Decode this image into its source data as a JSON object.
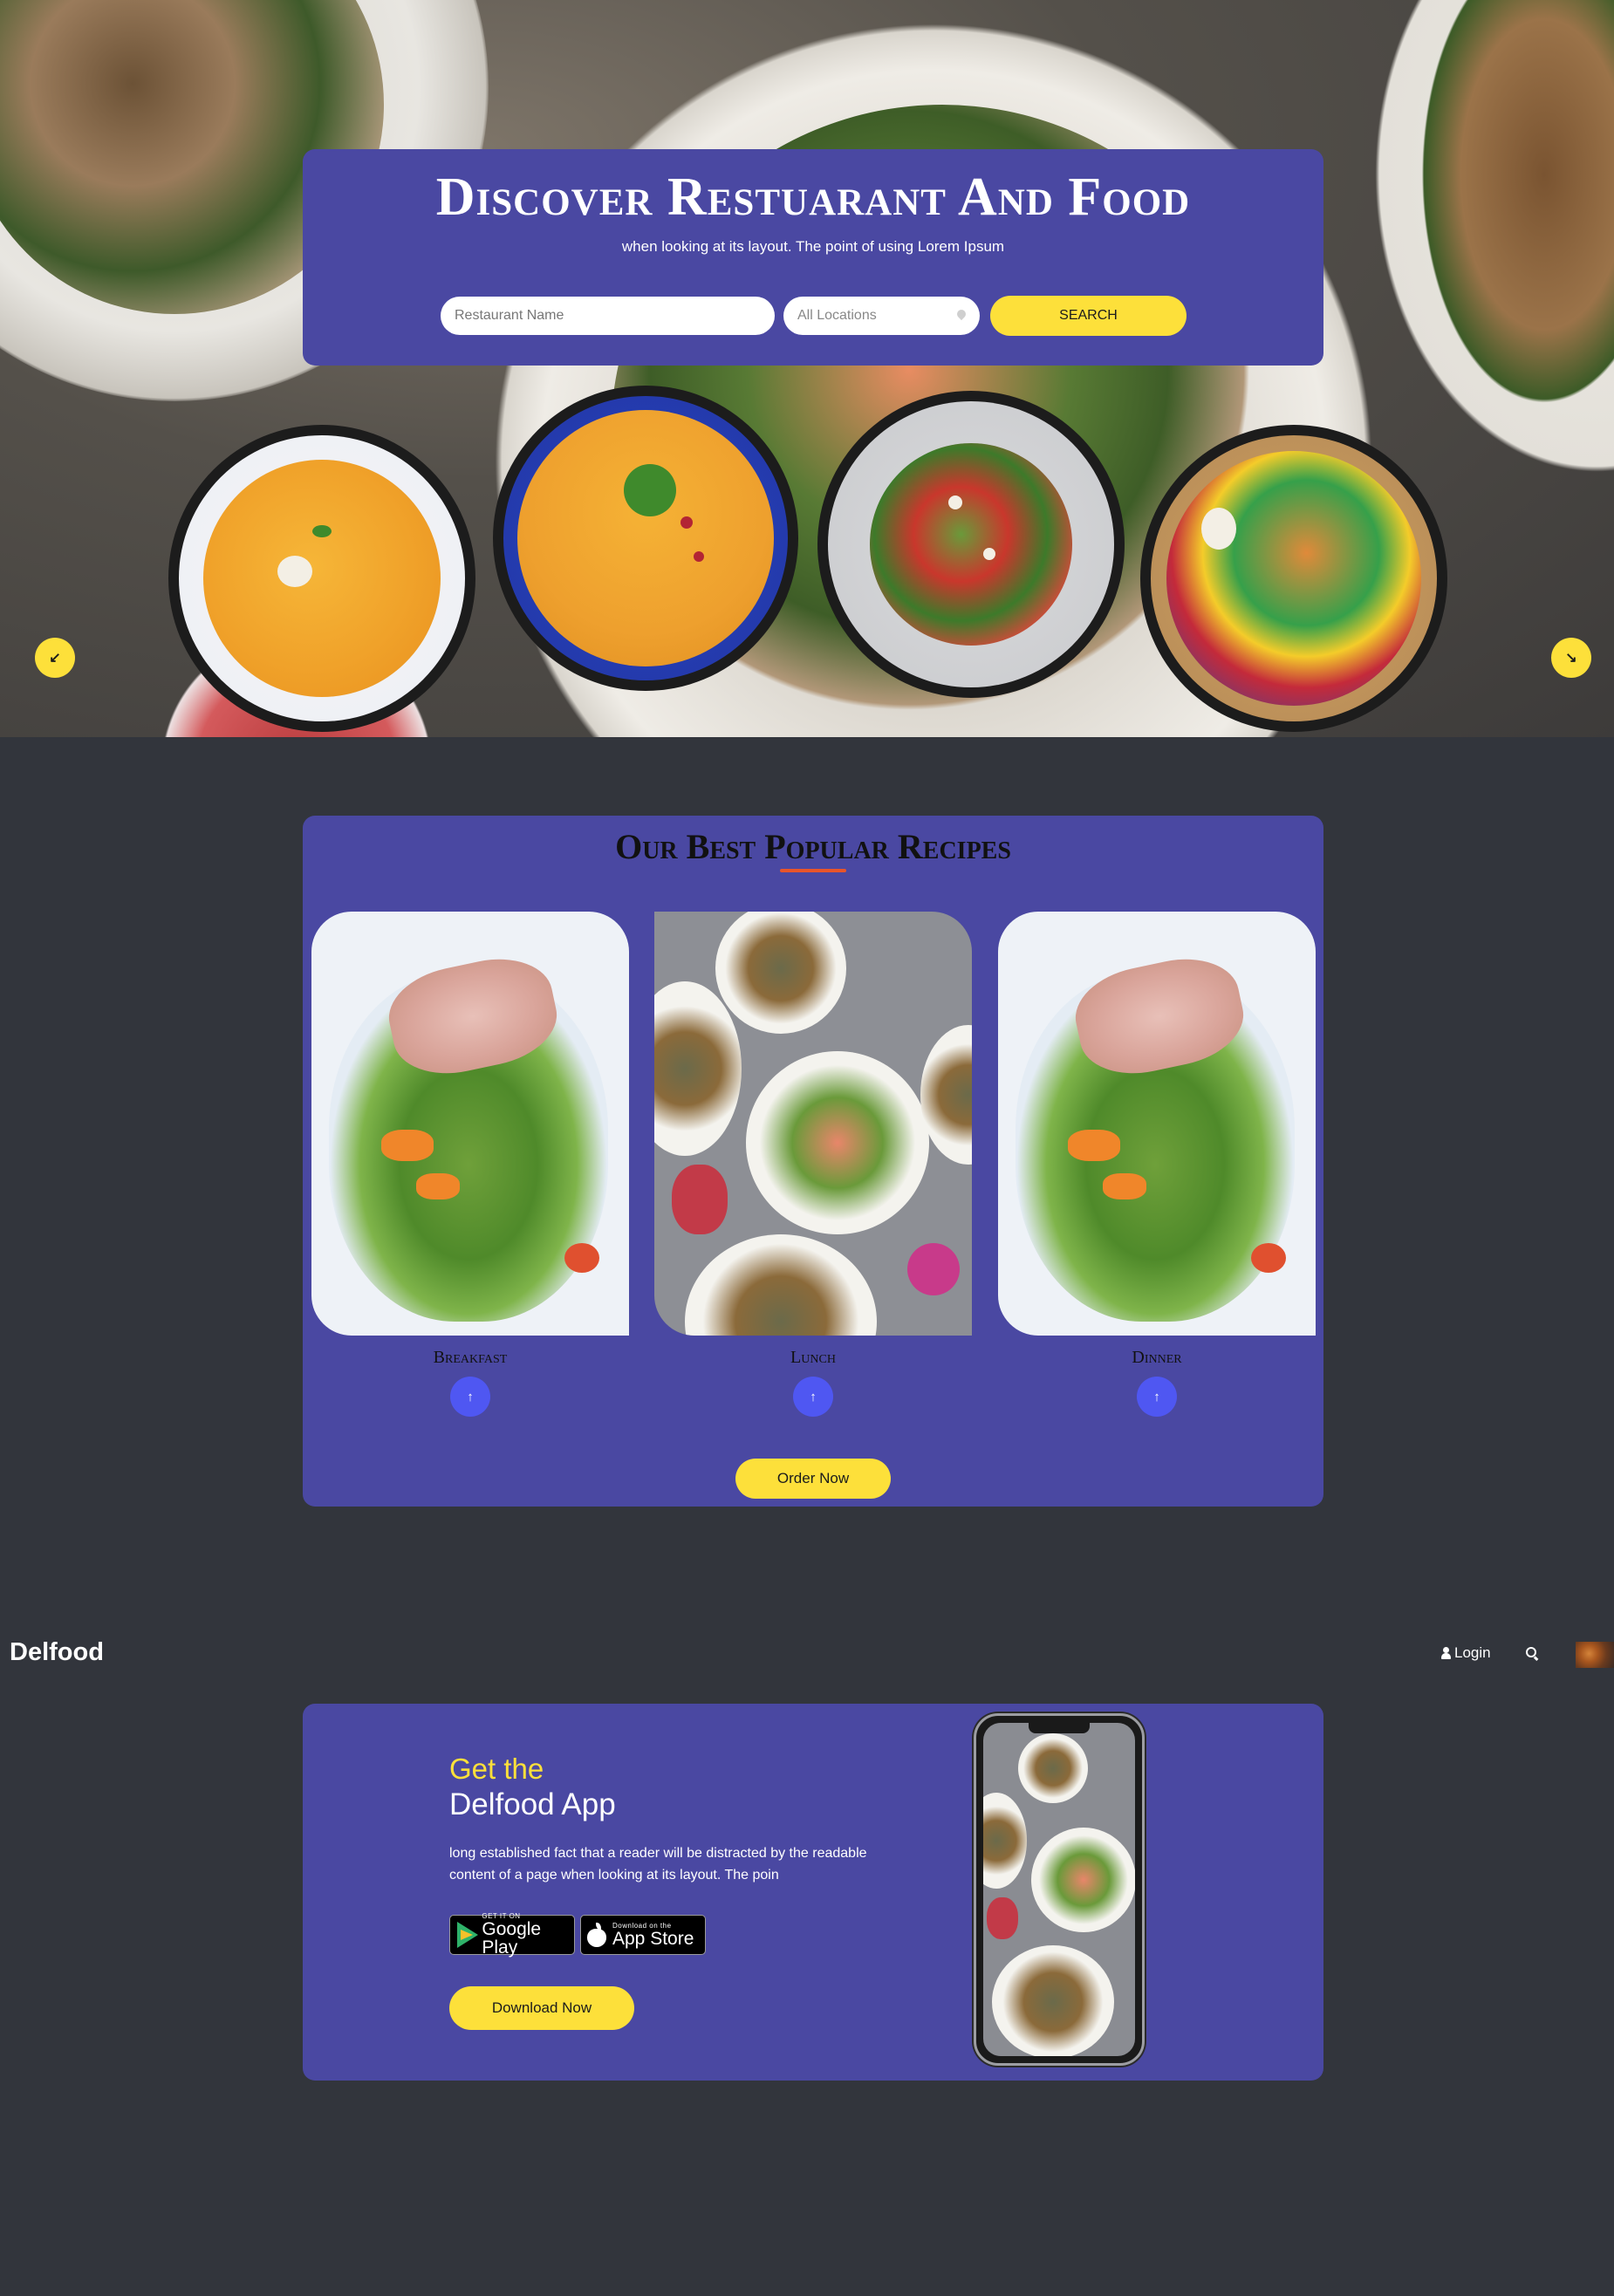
{
  "hero": {
    "title": "Discover Restuarant And Food",
    "subtitle": "when looking at its layout. The point of using Lorem Ipsum",
    "search": {
      "restaurant_placeholder": "Restaurant Name",
      "location_value": "All Locations",
      "button_label": "SEARCH"
    },
    "carousel": {
      "prev_icon": "arrow-down-left-icon",
      "next_icon": "arrow-down-right-icon"
    }
  },
  "recipes": {
    "title": "Our Best Popular Recipes",
    "items": [
      {
        "label": "Breakfast"
      },
      {
        "label": "Lunch"
      },
      {
        "label": "Dinner"
      }
    ],
    "order_button": "Order Now"
  },
  "nav": {
    "brand": "Delfood",
    "login": "Login",
    "search_icon": "search-icon",
    "user_icon": "user-icon"
  },
  "app_promo": {
    "heading_accent": "Get the",
    "heading": "Delfood App",
    "description": "long established fact that a reader will be distracted by the readable content of a page when looking at its layout. The poin",
    "google_play": {
      "small": "GET IT ON",
      "big": "Google Play"
    },
    "app_store": {
      "small": "Download on the",
      "big": "App Store"
    },
    "download_button": "Download Now"
  },
  "colors": {
    "panel": "#4a48a2",
    "accent_yellow": "#fde03a",
    "accent_blue": "#4f57f2",
    "underline_orange": "#e8552a",
    "page_background": "#32353c"
  }
}
